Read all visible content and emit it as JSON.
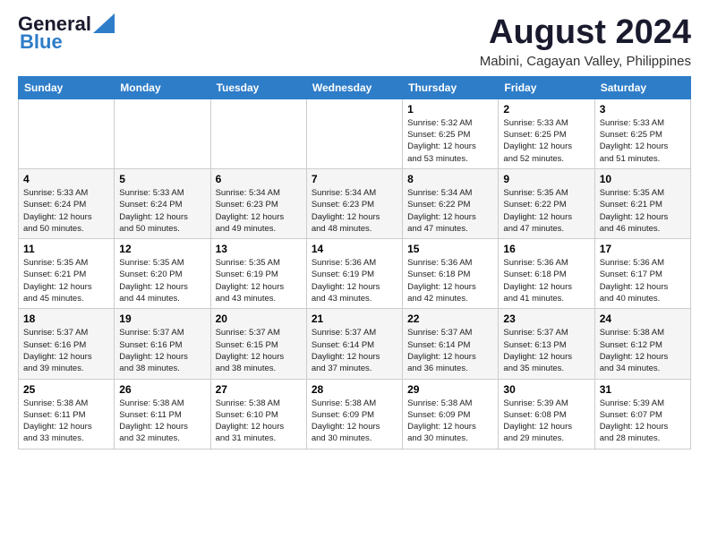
{
  "header": {
    "logo_line1": "General",
    "logo_line2": "Blue",
    "month": "August 2024",
    "location": "Mabini, Cagayan Valley, Philippines"
  },
  "weekdays": [
    "Sunday",
    "Monday",
    "Tuesday",
    "Wednesday",
    "Thursday",
    "Friday",
    "Saturday"
  ],
  "weeks": [
    [
      {
        "day": "",
        "text": ""
      },
      {
        "day": "",
        "text": ""
      },
      {
        "day": "",
        "text": ""
      },
      {
        "day": "",
        "text": ""
      },
      {
        "day": "1",
        "text": "Sunrise: 5:32 AM\nSunset: 6:25 PM\nDaylight: 12 hours\nand 53 minutes."
      },
      {
        "day": "2",
        "text": "Sunrise: 5:33 AM\nSunset: 6:25 PM\nDaylight: 12 hours\nand 52 minutes."
      },
      {
        "day": "3",
        "text": "Sunrise: 5:33 AM\nSunset: 6:25 PM\nDaylight: 12 hours\nand 51 minutes."
      }
    ],
    [
      {
        "day": "4",
        "text": "Sunrise: 5:33 AM\nSunset: 6:24 PM\nDaylight: 12 hours\nand 50 minutes."
      },
      {
        "day": "5",
        "text": "Sunrise: 5:33 AM\nSunset: 6:24 PM\nDaylight: 12 hours\nand 50 minutes."
      },
      {
        "day": "6",
        "text": "Sunrise: 5:34 AM\nSunset: 6:23 PM\nDaylight: 12 hours\nand 49 minutes."
      },
      {
        "day": "7",
        "text": "Sunrise: 5:34 AM\nSunset: 6:23 PM\nDaylight: 12 hours\nand 48 minutes."
      },
      {
        "day": "8",
        "text": "Sunrise: 5:34 AM\nSunset: 6:22 PM\nDaylight: 12 hours\nand 47 minutes."
      },
      {
        "day": "9",
        "text": "Sunrise: 5:35 AM\nSunset: 6:22 PM\nDaylight: 12 hours\nand 47 minutes."
      },
      {
        "day": "10",
        "text": "Sunrise: 5:35 AM\nSunset: 6:21 PM\nDaylight: 12 hours\nand 46 minutes."
      }
    ],
    [
      {
        "day": "11",
        "text": "Sunrise: 5:35 AM\nSunset: 6:21 PM\nDaylight: 12 hours\nand 45 minutes."
      },
      {
        "day": "12",
        "text": "Sunrise: 5:35 AM\nSunset: 6:20 PM\nDaylight: 12 hours\nand 44 minutes."
      },
      {
        "day": "13",
        "text": "Sunrise: 5:35 AM\nSunset: 6:19 PM\nDaylight: 12 hours\nand 43 minutes."
      },
      {
        "day": "14",
        "text": "Sunrise: 5:36 AM\nSunset: 6:19 PM\nDaylight: 12 hours\nand 43 minutes."
      },
      {
        "day": "15",
        "text": "Sunrise: 5:36 AM\nSunset: 6:18 PM\nDaylight: 12 hours\nand 42 minutes."
      },
      {
        "day": "16",
        "text": "Sunrise: 5:36 AM\nSunset: 6:18 PM\nDaylight: 12 hours\nand 41 minutes."
      },
      {
        "day": "17",
        "text": "Sunrise: 5:36 AM\nSunset: 6:17 PM\nDaylight: 12 hours\nand 40 minutes."
      }
    ],
    [
      {
        "day": "18",
        "text": "Sunrise: 5:37 AM\nSunset: 6:16 PM\nDaylight: 12 hours\nand 39 minutes."
      },
      {
        "day": "19",
        "text": "Sunrise: 5:37 AM\nSunset: 6:16 PM\nDaylight: 12 hours\nand 38 minutes."
      },
      {
        "day": "20",
        "text": "Sunrise: 5:37 AM\nSunset: 6:15 PM\nDaylight: 12 hours\nand 38 minutes."
      },
      {
        "day": "21",
        "text": "Sunrise: 5:37 AM\nSunset: 6:14 PM\nDaylight: 12 hours\nand 37 minutes."
      },
      {
        "day": "22",
        "text": "Sunrise: 5:37 AM\nSunset: 6:14 PM\nDaylight: 12 hours\nand 36 minutes."
      },
      {
        "day": "23",
        "text": "Sunrise: 5:37 AM\nSunset: 6:13 PM\nDaylight: 12 hours\nand 35 minutes."
      },
      {
        "day": "24",
        "text": "Sunrise: 5:38 AM\nSunset: 6:12 PM\nDaylight: 12 hours\nand 34 minutes."
      }
    ],
    [
      {
        "day": "25",
        "text": "Sunrise: 5:38 AM\nSunset: 6:11 PM\nDaylight: 12 hours\nand 33 minutes."
      },
      {
        "day": "26",
        "text": "Sunrise: 5:38 AM\nSunset: 6:11 PM\nDaylight: 12 hours\nand 32 minutes."
      },
      {
        "day": "27",
        "text": "Sunrise: 5:38 AM\nSunset: 6:10 PM\nDaylight: 12 hours\nand 31 minutes."
      },
      {
        "day": "28",
        "text": "Sunrise: 5:38 AM\nSunset: 6:09 PM\nDaylight: 12 hours\nand 30 minutes."
      },
      {
        "day": "29",
        "text": "Sunrise: 5:38 AM\nSunset: 6:09 PM\nDaylight: 12 hours\nand 30 minutes."
      },
      {
        "day": "30",
        "text": "Sunrise: 5:39 AM\nSunset: 6:08 PM\nDaylight: 12 hours\nand 29 minutes."
      },
      {
        "day": "31",
        "text": "Sunrise: 5:39 AM\nSunset: 6:07 PM\nDaylight: 12 hours\nand 28 minutes."
      }
    ]
  ]
}
